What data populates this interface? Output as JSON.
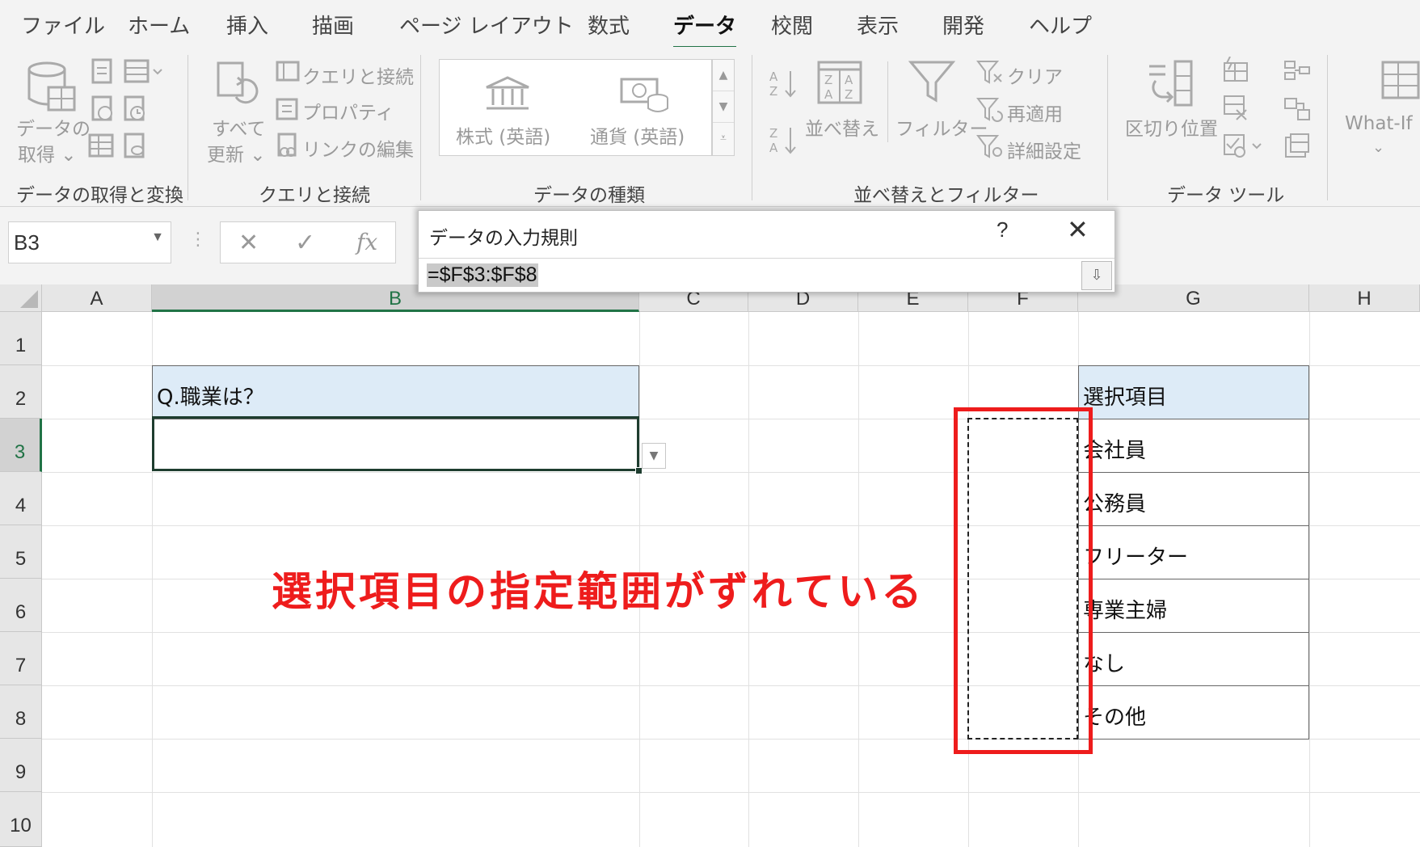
{
  "ribbon_tabs": [
    "ファイル",
    "ホーム",
    "挿入",
    "描画",
    "ページ レイアウト",
    "数式",
    "データ",
    "校閲",
    "表示",
    "開発",
    "ヘルプ"
  ],
  "active_tab": "データ",
  "groups": {
    "get_transform": {
      "label": "データの取得と変換",
      "get_data_line1": "データの",
      "get_data_line2": "取得 ⌄"
    },
    "queries": {
      "label": "クエリと接続",
      "refresh_line1": "すべて",
      "refresh_line2": "更新 ⌄",
      "queries_connections": "クエリと接続",
      "properties": "プロパティ",
      "edit_links": "リンクの編集"
    },
    "data_types": {
      "label": "データの種類",
      "stocks": "株式 (英語)",
      "currencies": "通貨 (英語)"
    },
    "sort_filter": {
      "label": "並べ替えとフィルター",
      "sort": "並べ替え",
      "filter": "フィルター",
      "clear": "クリア",
      "reapply": "再適用",
      "advanced": "詳細設定"
    },
    "data_tools": {
      "label": "データ ツール",
      "text_to_columns": "区切り位置"
    },
    "forecast": {
      "what_if": "What-If"
    }
  },
  "formula_bar": {
    "name_box": "B3",
    "fx": "fx"
  },
  "columns": [
    "A",
    "B",
    "C",
    "D",
    "E",
    "F",
    "G",
    "H"
  ],
  "rows": [
    "1",
    "2",
    "3",
    "4",
    "5",
    "6",
    "7",
    "8",
    "9",
    "10"
  ],
  "cells": {
    "B2": "Q.職業は？",
    "G2": "選択項目",
    "G3": "会社員",
    "G4": "公務員",
    "G5": "フリーター",
    "G6": "専業主婦",
    "G7": "なし",
    "G8": "その他"
  },
  "dialog": {
    "title": "データの入力規則",
    "help": "?",
    "close": "✕",
    "input_value": "=$F$3:$F$8"
  },
  "annotation": "選択項目の指定範囲がずれている",
  "colors": {
    "excel_green": "#217346",
    "header_fill": "#ddebf7",
    "annotation_red": "#ee1c1c"
  }
}
